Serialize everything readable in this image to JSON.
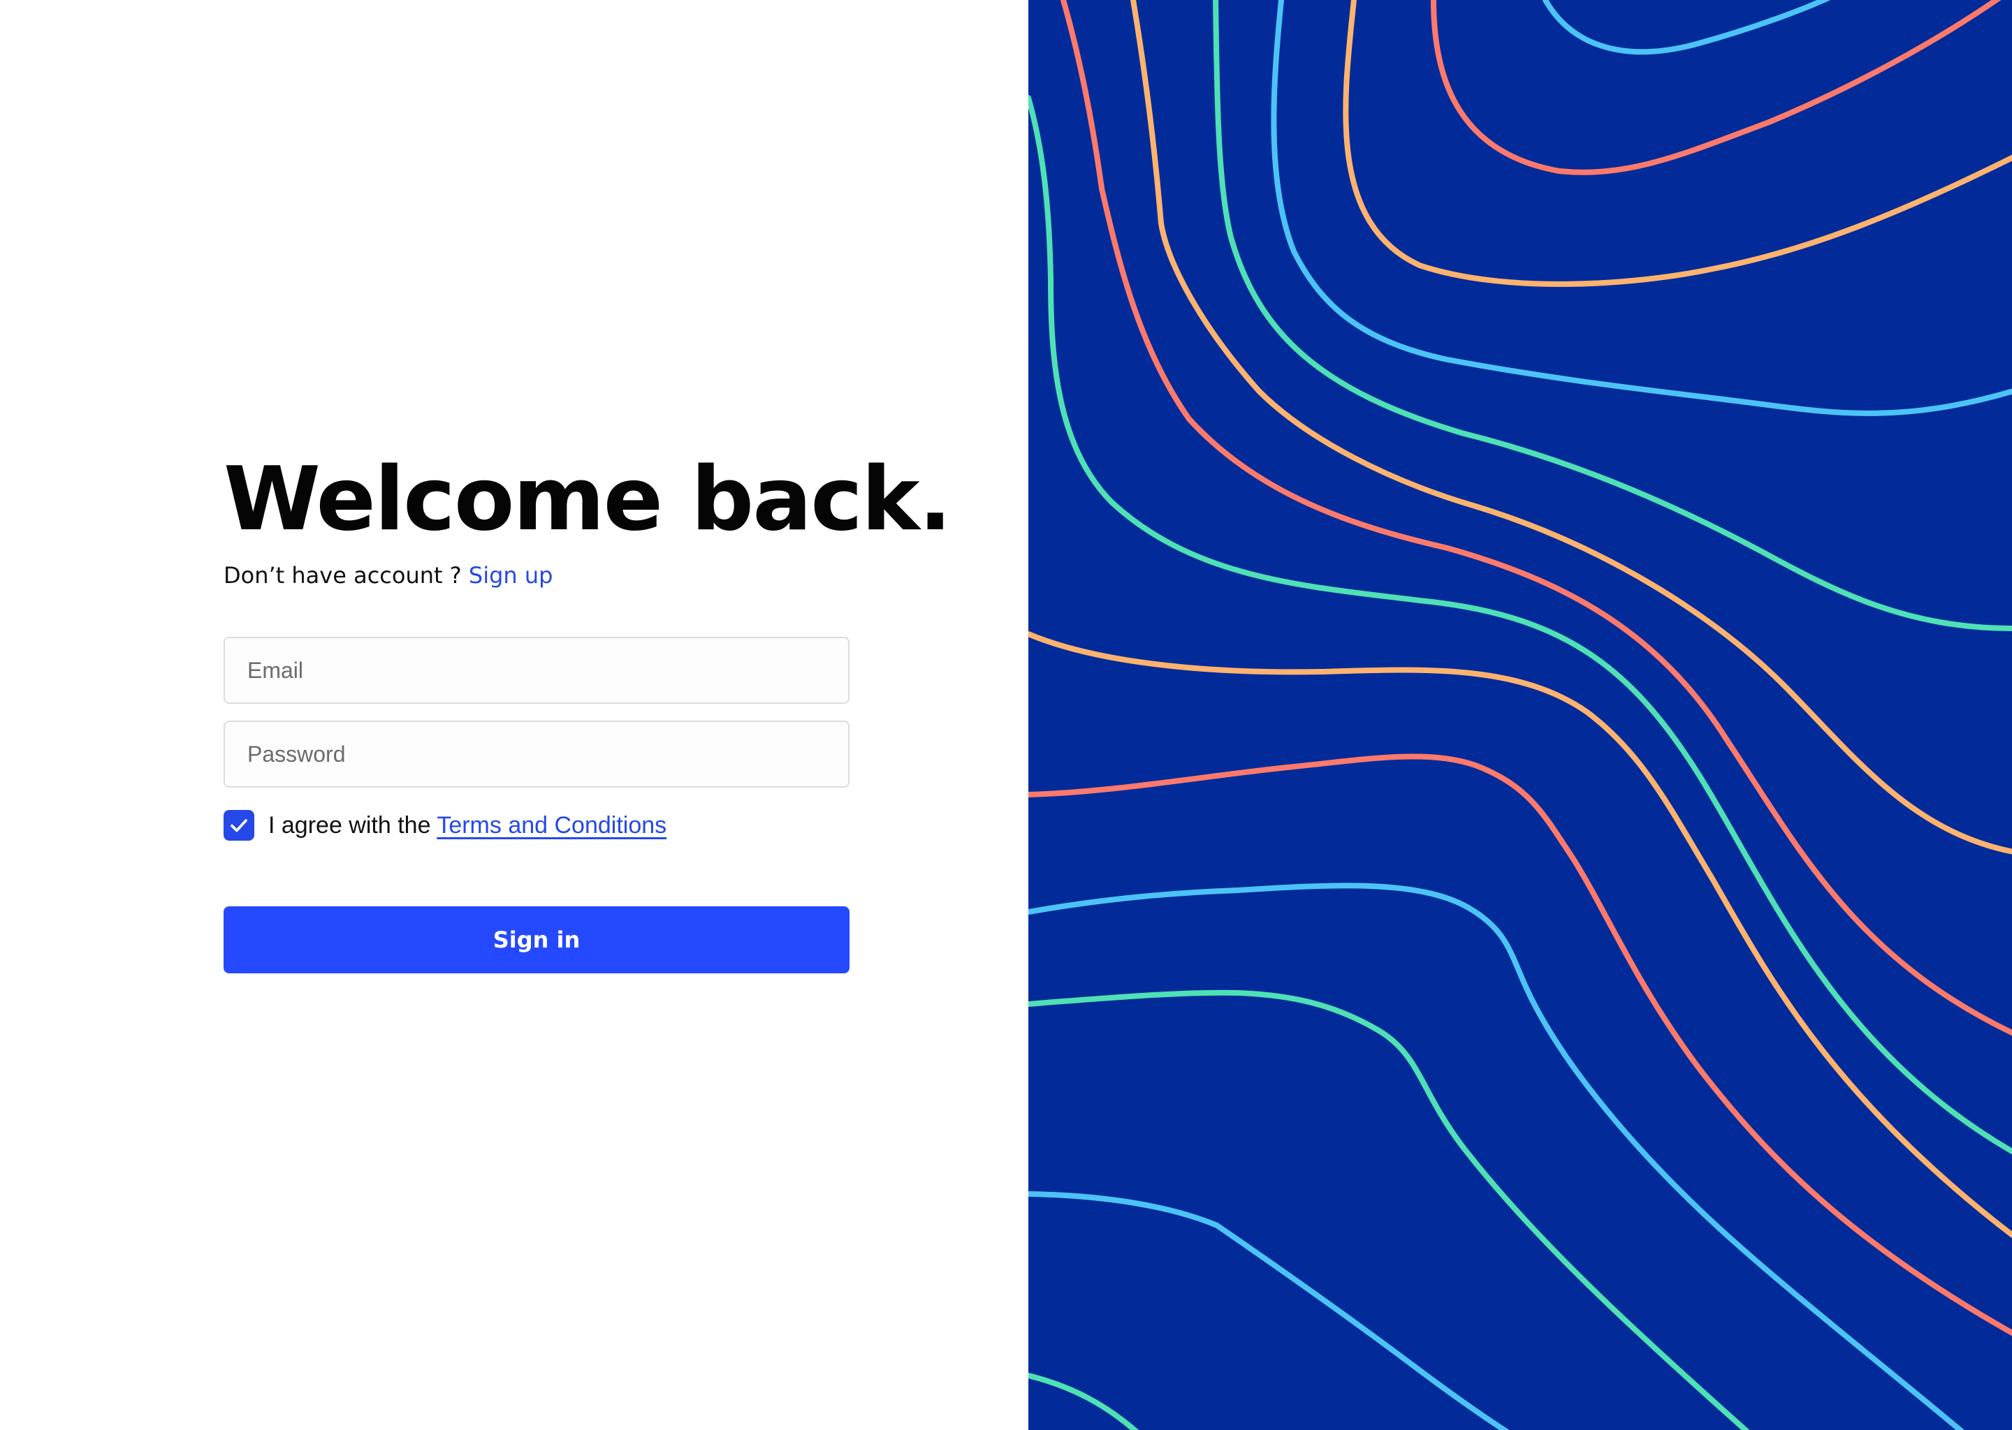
{
  "login": {
    "title": "Welcome back.",
    "no_account_text": "Don’t have account ?",
    "signup_link": "Sign up",
    "email_placeholder": "Email",
    "password_placeholder": "Password",
    "agree_text": "I agree with the",
    "terms_link": "Terms and Conditions",
    "terms_checked": true,
    "submit_label": "Sign in"
  },
  "colors": {
    "accent": "#2449ff",
    "link": "#2449e8",
    "panel_background": "#022b99",
    "line_coral": "#ff7a6b",
    "line_orange": "#ffb36e",
    "line_mint": "#4fe0b5",
    "line_sky": "#4cc3f7"
  },
  "icons": {
    "checkbox": "check-icon"
  }
}
